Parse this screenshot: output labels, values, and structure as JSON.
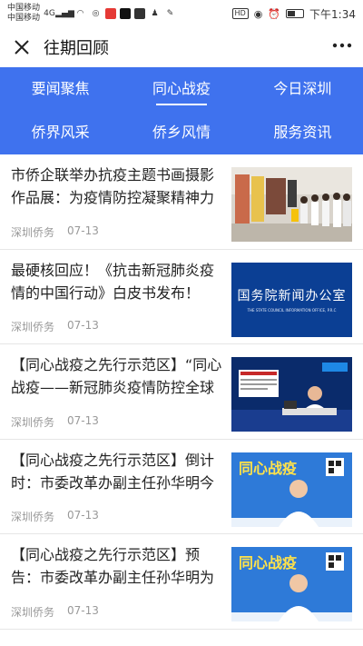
{
  "status_bar": {
    "carrier_1": "中国移动",
    "carrier_2": "中国移动",
    "network": "4G",
    "time": "下午1:34",
    "hd": "HD"
  },
  "header": {
    "title": "往期回顾",
    "close_icon": "close-icon",
    "more_icon": "more-icon"
  },
  "nav": {
    "row1": [
      "要闻聚焦",
      "同心战疫",
      "今日深圳"
    ],
    "row2": [
      "侨界风采",
      "侨乡风情",
      "服务资讯"
    ],
    "active": "同心战疫",
    "background": "#3f72ee"
  },
  "articles": [
    {
      "title": "市侨企联举办抗疫主题书画摄影作品展：为疫情防控凝聚精神力量",
      "source": "深圳侨务",
      "date": "07-13"
    },
    {
      "title": "最硬核回应！《抗击新冠肺炎疫情的中国行动》白皮书发布！",
      "source": "深圳侨务",
      "date": "07-13",
      "thumb_text": "国务院新闻办公室",
      "thumb_subtext": "THE STATE COUNCIL INFORMATION OFFICE, P.R.C"
    },
    {
      "title": "【同心战疫之先行示范区】“同心战疫——新冠肺炎疫情防控全球播",
      "source": "深圳侨务",
      "date": "07-13"
    },
    {
      "title": "【同心战疫之先行示范区】倒计时：市委改革办副主任孙华明今晚",
      "source": "深圳侨务",
      "date": "07-13",
      "thumb_text": "同心战疫"
    },
    {
      "title": "【同心战疫之先行示范区】预告：市委改革办副主任孙华明为您解读",
      "source": "深圳侨务",
      "date": "07-13",
      "thumb_text": "同心战疫"
    }
  ]
}
